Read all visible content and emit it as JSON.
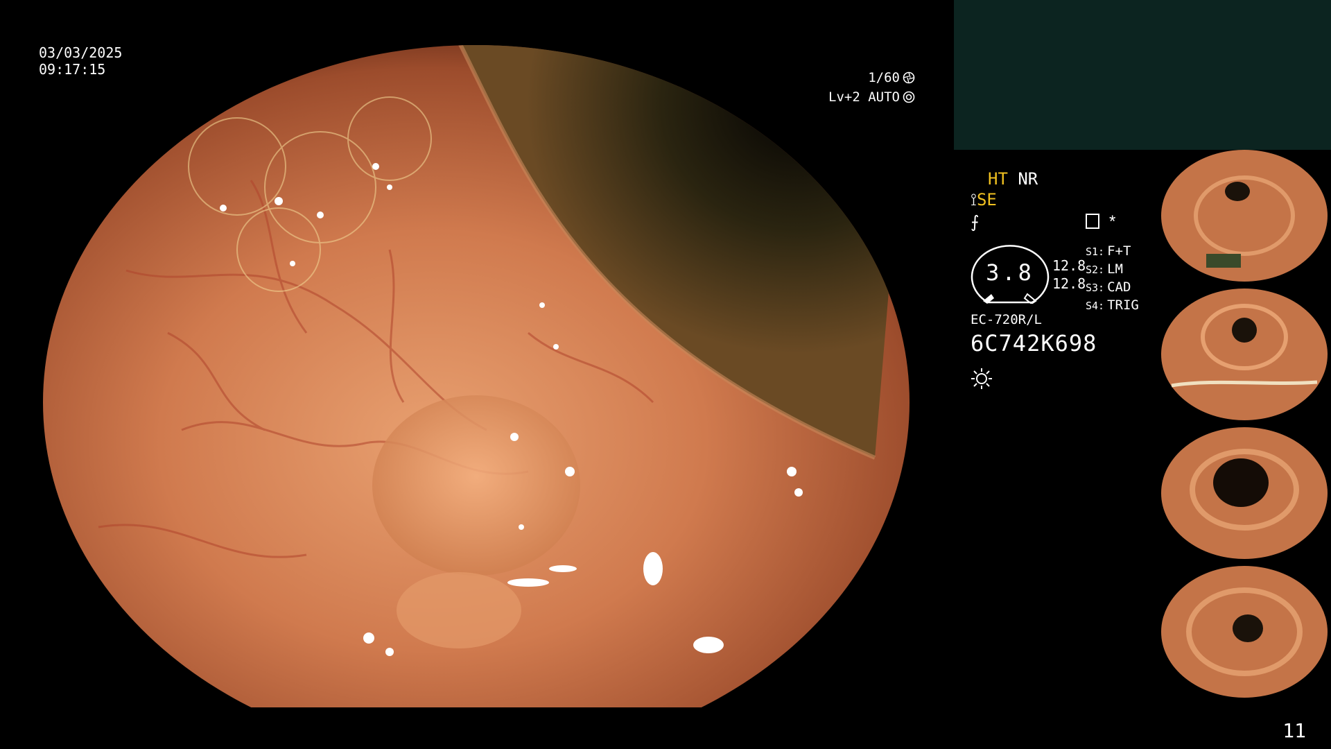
{
  "overlay": {
    "date": "03/03/2025",
    "time": "09:17:15",
    "shutter": "1/60",
    "level": "Lv+2 AUTO"
  },
  "settings": {
    "ht": "HT",
    "nr": "NR",
    "se": "SE",
    "gauge_value": "3.8",
    "value_1": "12.8",
    "value_2": "12.8",
    "slots": [
      {
        "key": "S1:",
        "label": "F+T"
      },
      {
        "key": "S2:",
        "label": "LM"
      },
      {
        "key": "S3:",
        "label": "CAD"
      },
      {
        "key": "S4:",
        "label": "TRIG"
      }
    ],
    "model": "EC-720R/L",
    "serial": "6C742K698"
  },
  "icons": {
    "shutter": "aperture-icon",
    "auto": "auto-iris-icon",
    "curve": "curve-icon",
    "doc": "document-icon",
    "star": "asterisk-icon",
    "light": "sun-icon"
  },
  "thumbnail_count": 4,
  "page_number": "11",
  "colors": {
    "mucosa": "#d07a4e",
    "panel": "#0c2420",
    "highlight": "#f0c020"
  }
}
